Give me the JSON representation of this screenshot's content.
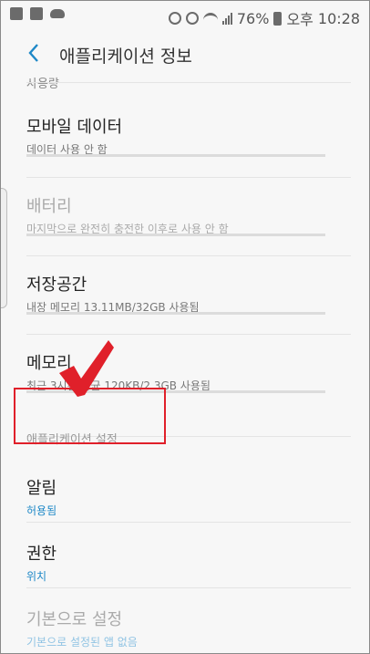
{
  "status_bar": {
    "battery": "76%",
    "ampm": "오후",
    "time": "10:28"
  },
  "header": {
    "title": "애플리케이션 정보"
  },
  "partial_top": "사용량",
  "items": [
    {
      "title": "모바일 데이터",
      "subtitle": "데이터 사용 안 함"
    },
    {
      "title": "배터리",
      "subtitle": "마지막으로 완전히 충전한 이후로 사용 안 함"
    },
    {
      "title": "저장공간",
      "subtitle": "내장 메모리 13.11MB/32GB 사용됨"
    },
    {
      "title": "메모리",
      "subtitle": "최근 3시간 평균 120KB/2.3GB 사용됨"
    }
  ],
  "section_label": "애플리케이션 설정",
  "settings": [
    {
      "title": "알림",
      "subtitle": "허용됨"
    },
    {
      "title": "권한",
      "subtitle": "위치"
    },
    {
      "title": "기본으로 설정",
      "subtitle": "기본으로 설정된 앱 없음"
    }
  ],
  "colors": {
    "accent": "#1e88c7",
    "highlight": "#e0202a"
  }
}
